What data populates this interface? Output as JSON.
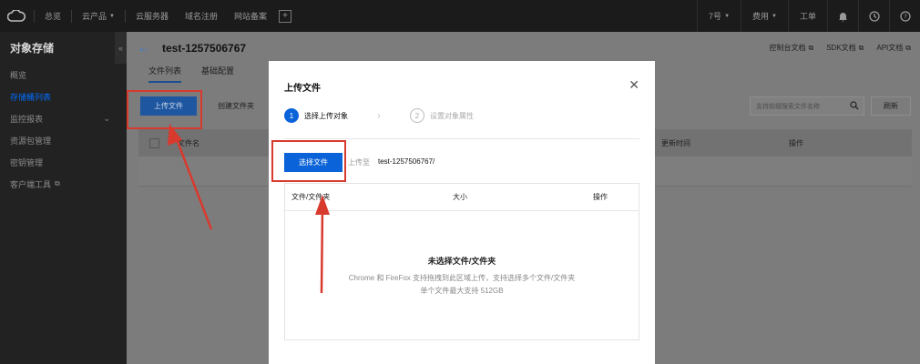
{
  "topbar": {
    "items": [
      {
        "label": "总览"
      },
      {
        "label": "云产品",
        "icon": "chevron-down-icon"
      },
      {
        "label": "云服务器"
      },
      {
        "label": "域名注册"
      },
      {
        "label": "网站备案"
      }
    ],
    "right": {
      "region": "7号",
      "billing": "费用",
      "ticket": "工单"
    }
  },
  "sidebar": {
    "title": "对象存储",
    "collapse_glyph": "«",
    "items": [
      {
        "label": "概览"
      },
      {
        "label": "存储桶列表"
      },
      {
        "label": "监控报表"
      },
      {
        "label": "资源包管理"
      },
      {
        "label": "密钥管理"
      },
      {
        "label": "客户端工具"
      }
    ]
  },
  "main": {
    "title": "test-1257506767",
    "doc_links": [
      "控制台文档",
      "SDK文档",
      "API文档"
    ],
    "tabs": [
      "文件列表",
      "基础配置"
    ],
    "upload_label": "上传文件",
    "create_folder_label": "创建文件夹",
    "search_placeholder": "支持前缀搜索文件名称",
    "refresh_label": "刷新",
    "table": {
      "col_name": "文件名",
      "col_updated": "更新时间",
      "col_action": "操作"
    }
  },
  "modal": {
    "title": "上传文件",
    "steps": [
      {
        "num": "1",
        "label": "选择上传对象"
      },
      {
        "num": "2",
        "label": "设置对象属性"
      }
    ],
    "select_label": "选择文件",
    "upload_to_label": "上传至",
    "upload_path": "test-1257506767/",
    "columns": [
      "文件/文件夹",
      "大小",
      "操作"
    ],
    "empty_title": "未选择文件/文件夹",
    "empty_line1": "Chrome 和 FireFox 支持拖拽到此区域上传，支持选择多个文件/文件夹",
    "empty_line2": "单个文件最大支持 512GB"
  },
  "colors": {
    "accent": "#0a63d8",
    "annotation": "#d83a2e"
  }
}
